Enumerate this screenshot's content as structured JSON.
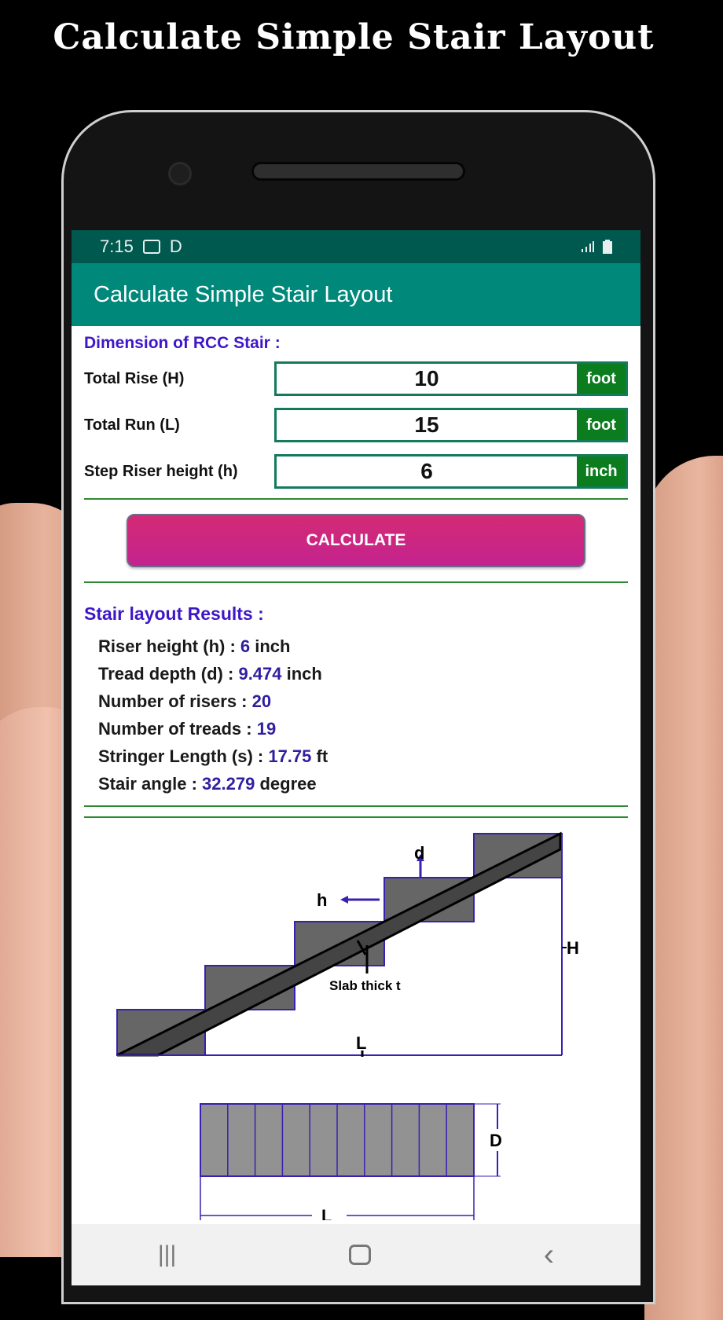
{
  "promo": {
    "title": "Calculate Simple Stair Layout"
  },
  "status_bar": {
    "time": "7:15",
    "icons": [
      "sim-icon",
      "d-icon"
    ],
    "right_icons": [
      "signal-icon",
      "battery-icon"
    ]
  },
  "app_bar": {
    "title": "Calculate Simple Stair Layout"
  },
  "inputs": {
    "section_title": "Dimension of RCC Stair :",
    "fields": [
      {
        "label": "Total Rise (H)",
        "value": "10",
        "unit": "foot"
      },
      {
        "label": "Total Run (L)",
        "value": "15",
        "unit": "foot"
      },
      {
        "label": "Step Riser height (h)",
        "value": "6",
        "unit": "inch"
      }
    ]
  },
  "calculate_button": {
    "label": "CALCULATE"
  },
  "results": {
    "title": "Stair layout Results :",
    "items": [
      {
        "label": "Riser height (h) : ",
        "value": "6",
        "unit": " inch"
      },
      {
        "label": "Tread depth (d) : ",
        "value": "9.474",
        "unit": " inch"
      },
      {
        "label": "Number of risers : ",
        "value": "20",
        "unit": ""
      },
      {
        "label": "Number of treads : ",
        "value": "19",
        "unit": ""
      },
      {
        "label": "Stringer Length (s) : ",
        "value": "17.75",
        "unit": " ft"
      },
      {
        "label": "Stair angle : ",
        "value": "32.279",
        "unit": " degree"
      }
    ]
  },
  "diagram": {
    "labels": {
      "d": "d",
      "h": "h",
      "H": "H",
      "L": "L",
      "slab": "Slab thick t",
      "D": "D",
      "L2": "L"
    },
    "colors": {
      "step_fill": "#666666",
      "slab_fill": "#444444",
      "dim_line": "#3b1fb0",
      "plan_fill": "#929292"
    },
    "plan_treads": 10
  },
  "nav_bar": {
    "recents": "|||",
    "home": "○",
    "back": "‹"
  }
}
